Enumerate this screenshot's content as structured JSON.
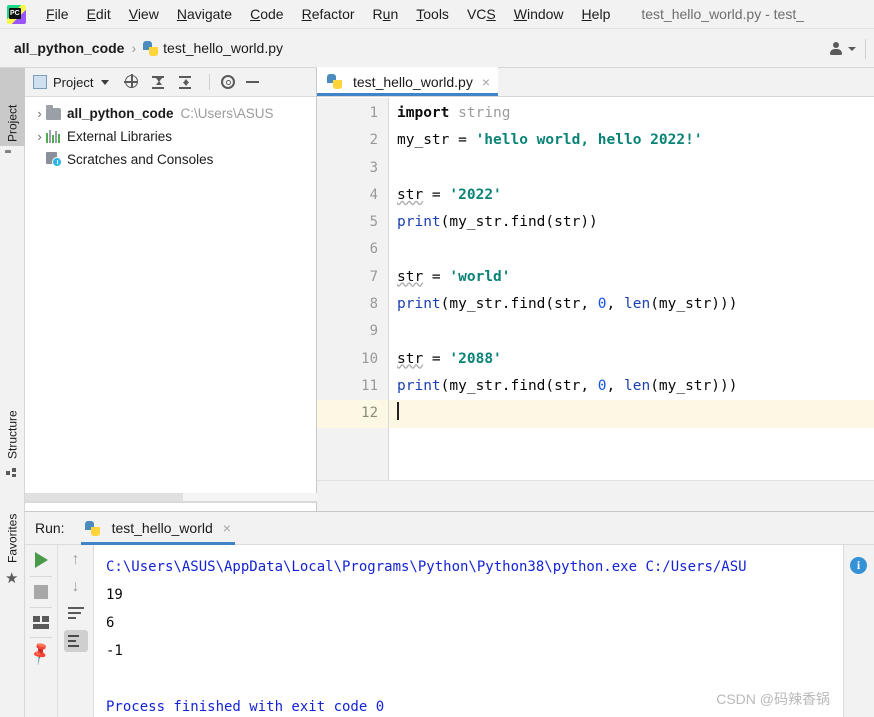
{
  "window": {
    "title": "test_hello_world.py - test_",
    "app_icon": "pycharm-logo-icon"
  },
  "menubar": {
    "items": [
      {
        "label": "File",
        "mnemonic": "F"
      },
      {
        "label": "Edit",
        "mnemonic": "E"
      },
      {
        "label": "View",
        "mnemonic": "V"
      },
      {
        "label": "Navigate",
        "mnemonic": "N"
      },
      {
        "label": "Code",
        "mnemonic": "C"
      },
      {
        "label": "Refactor",
        "mnemonic": "R"
      },
      {
        "label": "Run",
        "mnemonic": "u"
      },
      {
        "label": "Tools",
        "mnemonic": "T"
      },
      {
        "label": "VCS",
        "mnemonic": "S"
      },
      {
        "label": "Window",
        "mnemonic": "W"
      },
      {
        "label": "Help",
        "mnemonic": "H"
      }
    ]
  },
  "navbar": {
    "crumbs": [
      "all_python_code",
      "test_hello_world.py"
    ],
    "separator": "›",
    "account_icon": "person-icon"
  },
  "left_strip": {
    "top_tabs": [
      {
        "label": "Project",
        "icon": "folder-icon",
        "active": true
      }
    ],
    "bottom_tabs": [
      {
        "label": "Structure",
        "icon": "structure-icon"
      },
      {
        "label": "Favorites",
        "icon": "star-icon"
      }
    ]
  },
  "project_panel": {
    "title": "Project",
    "toolbar_icons": [
      "locate-target-icon",
      "expand-all-icon",
      "collapse-all-icon",
      "settings-gear-icon",
      "hide-minimize-icon"
    ],
    "tree": [
      {
        "label": "all_python_code",
        "path": "C:\\Users\\ASUS",
        "icon": "folder-icon",
        "chevron": "›",
        "bold": true
      },
      {
        "label": "External Libraries",
        "path": "",
        "icon": "libraries-icon",
        "chevron": "›",
        "bold": false
      },
      {
        "label": "Scratches and Consoles",
        "path": "",
        "icon": "scratches-icon",
        "chevron": "",
        "bold": false
      }
    ]
  },
  "editor": {
    "tab": {
      "label": "test_hello_world.py",
      "icon": "python-file-icon",
      "close": "×"
    },
    "cursor_line": 12,
    "lines": [
      {
        "n": 1,
        "tokens": [
          {
            "t": "import",
            "c": "kw"
          },
          {
            "t": " ",
            "c": "plain"
          },
          {
            "t": "string",
            "c": "unused"
          }
        ]
      },
      {
        "n": 2,
        "tokens": [
          {
            "t": "my_str = ",
            "c": "plain"
          },
          {
            "t": "'hello world, hello 2022!'",
            "c": "str"
          }
        ]
      },
      {
        "n": 3,
        "tokens": []
      },
      {
        "n": 4,
        "tokens": [
          {
            "t": "str",
            "c": "err"
          },
          {
            "t": " = ",
            "c": "plain"
          },
          {
            "t": "'2022'",
            "c": "str"
          }
        ]
      },
      {
        "n": 5,
        "tokens": [
          {
            "t": "print",
            "c": "fn"
          },
          {
            "t": "(my_str.find(str))",
            "c": "plain"
          }
        ]
      },
      {
        "n": 6,
        "tokens": []
      },
      {
        "n": 7,
        "tokens": [
          {
            "t": "str",
            "c": "err"
          },
          {
            "t": " = ",
            "c": "plain"
          },
          {
            "t": "'world'",
            "c": "str"
          }
        ]
      },
      {
        "n": 8,
        "tokens": [
          {
            "t": "print",
            "c": "fn"
          },
          {
            "t": "(my_str.find(str, ",
            "c": "plain"
          },
          {
            "t": "0",
            "c": "num"
          },
          {
            "t": ", ",
            "c": "plain"
          },
          {
            "t": "len",
            "c": "fn"
          },
          {
            "t": "(my_str)))",
            "c": "plain"
          }
        ]
      },
      {
        "n": 9,
        "tokens": []
      },
      {
        "n": 10,
        "tokens": [
          {
            "t": "str",
            "c": "err"
          },
          {
            "t": " = ",
            "c": "plain"
          },
          {
            "t": "'2088'",
            "c": "str"
          }
        ]
      },
      {
        "n": 11,
        "tokens": [
          {
            "t": "print",
            "c": "fn"
          },
          {
            "t": "(my_str.find(str, ",
            "c": "plain"
          },
          {
            "t": "0",
            "c": "num"
          },
          {
            "t": ", ",
            "c": "plain"
          },
          {
            "t": "len",
            "c": "fn"
          },
          {
            "t": "(my_str)))",
            "c": "plain"
          }
        ]
      },
      {
        "n": 12,
        "tokens": []
      }
    ]
  },
  "run_panel": {
    "label": "Run:",
    "tab": {
      "label": "test_hello_world",
      "icon": "python-run-icon",
      "close": "×"
    },
    "toolbar_left": [
      "run-icon",
      "stop-icon",
      "layout-icon",
      "pin-icon"
    ],
    "toolbar_right": [
      "scroll-up-icon",
      "scroll-down-icon",
      "soft-wrap-icon",
      "scroll-to-end-icon"
    ],
    "console": [
      {
        "text": "C:\\Users\\ASUS\\AppData\\Local\\Programs\\Python\\Python38\\python.exe C:/Users/ASU",
        "color": "blue"
      },
      {
        "text": "19",
        "color": "black"
      },
      {
        "text": "6",
        "color": "black"
      },
      {
        "text": "-1",
        "color": "black"
      },
      {
        "text": "",
        "color": "black"
      },
      {
        "text": "Process finished with exit code 0",
        "color": "blue"
      }
    ],
    "watermark": "CSDN @码辣香锅",
    "info_icon": "info-icon",
    "info_glyph": "i"
  },
  "colors": {
    "accent_blue": "#4083c9",
    "string_teal": "#0a8377",
    "number_blue": "#1750eb",
    "console_blue": "#1423d6",
    "run_green": "#4a9a4a",
    "current_line": "#fdf8e3"
  }
}
